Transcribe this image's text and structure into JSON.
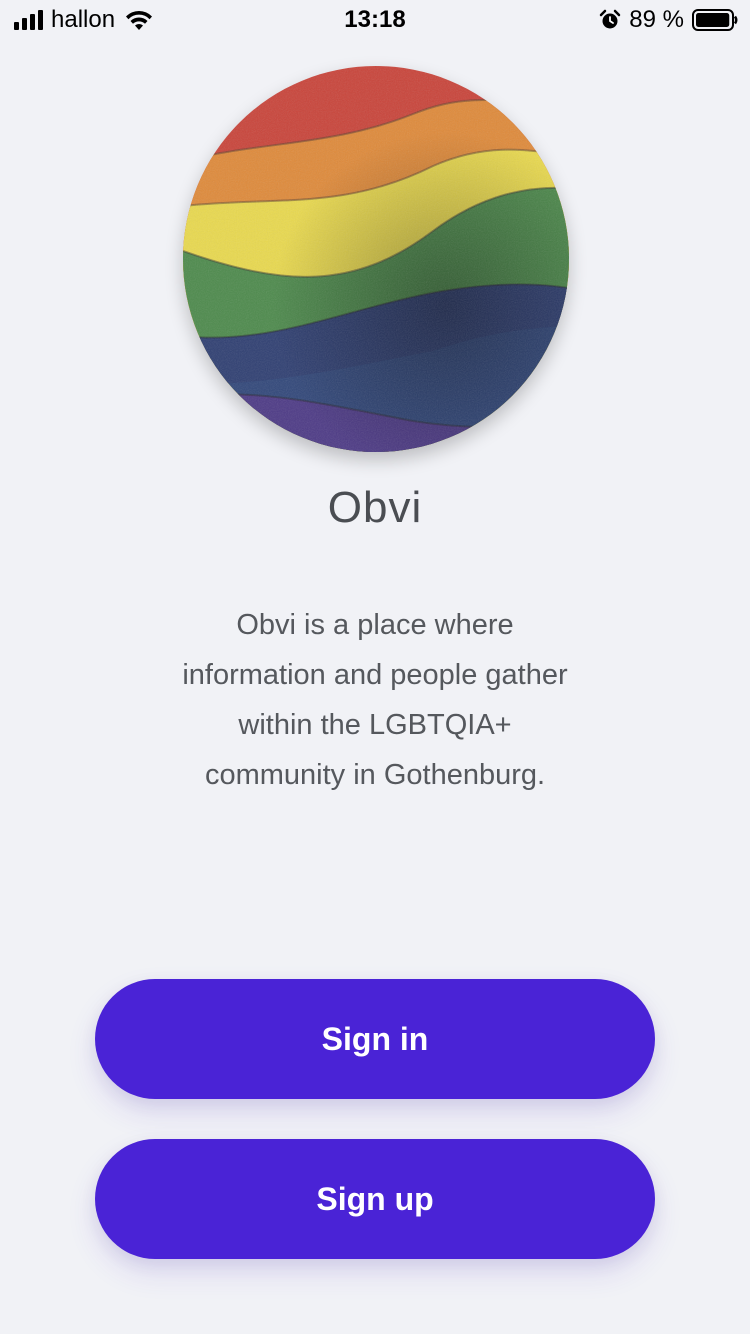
{
  "status_bar": {
    "carrier": "hallon",
    "time": "13:18",
    "battery_percent": "89 %",
    "battery_level": 0.89,
    "icons": [
      "signal-icon",
      "wifi-icon",
      "alarm-icon",
      "battery-icon"
    ]
  },
  "app": {
    "name": "Obvi",
    "logo_icon": "rainbow-wave-logo"
  },
  "description": [
    "Obvi is a place where",
    "information and people gather",
    "within the LGBTQIA+",
    "community in Gothenburg."
  ],
  "buttons": {
    "sign_in": "Sign in",
    "sign_up": "Sign up"
  },
  "colors": {
    "background": "#f1f2f6",
    "primary": "#4a23d6",
    "button_text": "#ffffff",
    "text": "#4a4d52"
  }
}
